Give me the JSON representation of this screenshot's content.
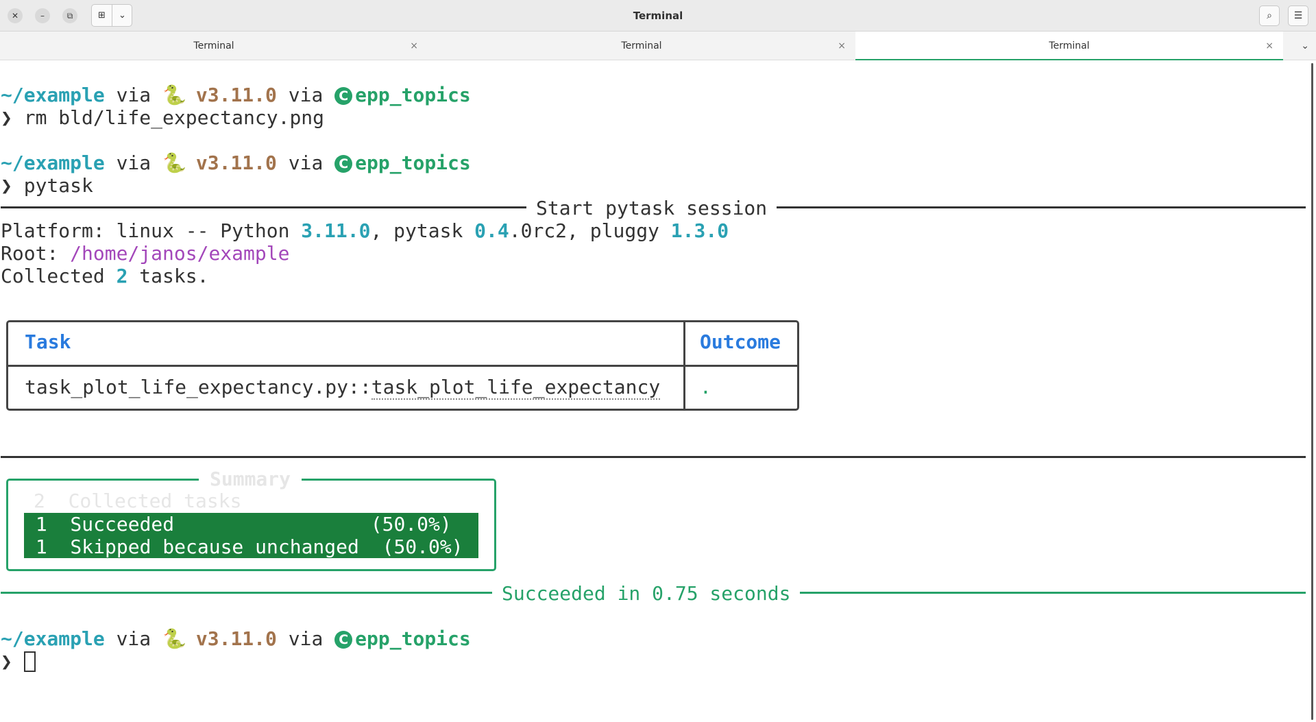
{
  "window": {
    "title": "Terminal",
    "controls": {
      "close": "✕",
      "minimize": "–",
      "maximize": "⧉"
    },
    "new_tab_icon": "⊞",
    "dropdown_icon": "⌄",
    "search_icon": "⌕",
    "menu_icon": "☰"
  },
  "tabs": [
    {
      "label": "Terminal",
      "close": "×"
    },
    {
      "label": "Terminal",
      "close": "×"
    },
    {
      "label": "Terminal",
      "close": "×"
    }
  ],
  "tab_menu_icon": "⌄",
  "prompt": {
    "dir": "~/example",
    "via1": " via ",
    "snake": "🐍",
    "pyver": " v3.11.0",
    "via2": " via ",
    "conda_icon": "C",
    "env": "epp_topics",
    "arrow": "❯"
  },
  "commands": {
    "cmd1": " rm bld/life_expectancy.png",
    "cmd2": " pytask"
  },
  "session": {
    "header": "Start pytask session",
    "platform_prefix": "Platform: linux -- Python ",
    "python_ver": "3.11.0",
    "pytask_prefix": ", pytask ",
    "pytask_ver_a": "0.4",
    "pytask_ver_b": ".0rc2",
    "pluggy_prefix": ", pluggy ",
    "pluggy_ver": "1.3.0",
    "root_label": "Root: ",
    "root_path": "/home/janos/example",
    "collected_a": "Collected ",
    "collected_n": "2",
    "collected_b": " tasks."
  },
  "table": {
    "col_task": "Task",
    "col_outcome": "Outcome",
    "row_file": "task_plot_life_expectancy.py::",
    "row_func": "task_plot_life_expectancy",
    "row_outcome": "."
  },
  "summary": {
    "title": "Summary",
    "collected": "2  Collected tasks",
    "rows": [
      {
        "text": " 1  Succeeded                 (50.0%) "
      },
      {
        "text": " 1  Skipped because unchanged  (50.0%) "
      }
    ],
    "footer": "Succeeded in 0.75 seconds"
  }
}
